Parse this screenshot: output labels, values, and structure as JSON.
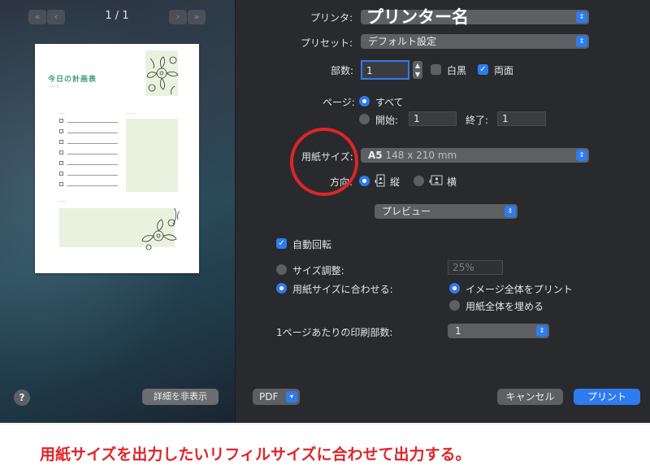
{
  "preview": {
    "prev_first": "«",
    "prev": "‹",
    "page_counter": "1 / 1",
    "next": "›",
    "next_last": "»",
    "document": {
      "title": "今日の計画表",
      "subtitle": "ワーク"
    }
  },
  "printer": {
    "label": "プリンタ:",
    "value": ""
  },
  "preset": {
    "label": "プリセット:",
    "value": "デフォルト設定"
  },
  "copies": {
    "label": "部数:",
    "value": "1",
    "bw_label": "白黒",
    "duplex_label": "両面",
    "bw_checked": false,
    "duplex_checked": true
  },
  "pages": {
    "label": "ページ:",
    "all_label": "すべて",
    "from_label": "開始:",
    "from_value": "1",
    "to_label": "終了:",
    "to_value": "1"
  },
  "paper_size": {
    "label": "用紙サイズ:",
    "value_bold": "A5",
    "value": "148 x 210 mm"
  },
  "orientation": {
    "label": "方向:",
    "portrait_label": "縦",
    "landscape_label": "横"
  },
  "section_menu": {
    "value": "プレビュー"
  },
  "auto_rotate": {
    "label": "自動回転",
    "checked": true
  },
  "scale": {
    "label": "サイズ調整:",
    "value": "25%"
  },
  "fit": {
    "label": "用紙サイズに合わせる:",
    "option_whole": "イメージ全体をプリント",
    "option_fill": "用紙全体を埋める"
  },
  "pages_per_sheet": {
    "label": "1ページあたりの印刷部数:",
    "value": "1"
  },
  "footer": {
    "help": "?",
    "hide_details": "詳細を非表示",
    "pdf": "PDF",
    "cancel": "キャンセル",
    "print": "プリント"
  },
  "annotations": {
    "printer_name": "プリンター名",
    "caption": "用紙サイズを出力したいリフィルサイズに合わせて出力する。",
    "highlight_color": "#e0242a"
  },
  "colors": {
    "accent": "#2f7bf0",
    "panel": "#292a2d"
  },
  "icons": {
    "stepper": "stepper-arrows-icon",
    "popup": "popup-arrows-icon",
    "portrait": "portrait-person-icon",
    "landscape": "landscape-person-icon"
  }
}
